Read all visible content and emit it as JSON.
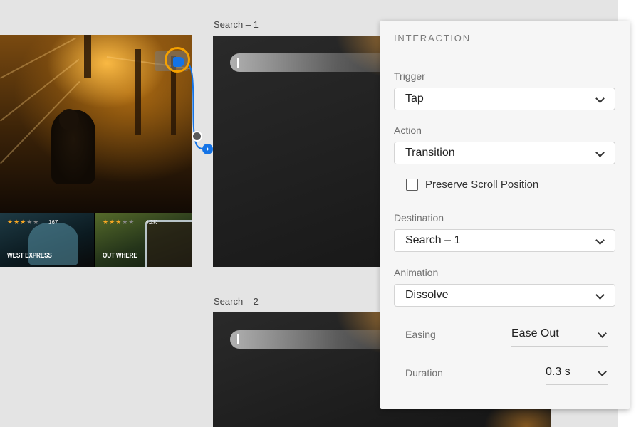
{
  "canvas": {
    "artboards": [
      {
        "label": ""
      },
      {
        "label": "Search – 1"
      },
      {
        "label": "Search – 2"
      }
    ],
    "home_thumbnails": [
      {
        "title": "WEST EXPRESS",
        "count": "167",
        "rating": 3
      },
      {
        "title": "OUT WHERE",
        "count": "4.2K",
        "rating": 3
      }
    ]
  },
  "panel": {
    "title": "INTERACTION",
    "trigger": {
      "label": "Trigger",
      "value": "Tap"
    },
    "action": {
      "label": "Action",
      "value": "Transition"
    },
    "preserve_scroll": {
      "label": "Preserve Scroll Position",
      "checked": false
    },
    "destination": {
      "label": "Destination",
      "value": "Search – 1"
    },
    "animation": {
      "label": "Animation",
      "value": "Dissolve"
    },
    "easing": {
      "label": "Easing",
      "value": "Ease Out"
    },
    "duration": {
      "label": "Duration",
      "value": "0.3 s"
    }
  },
  "colors": {
    "accent": "#1473e6",
    "hotspot_ring": "#f5a100",
    "star": "#f5a623"
  }
}
